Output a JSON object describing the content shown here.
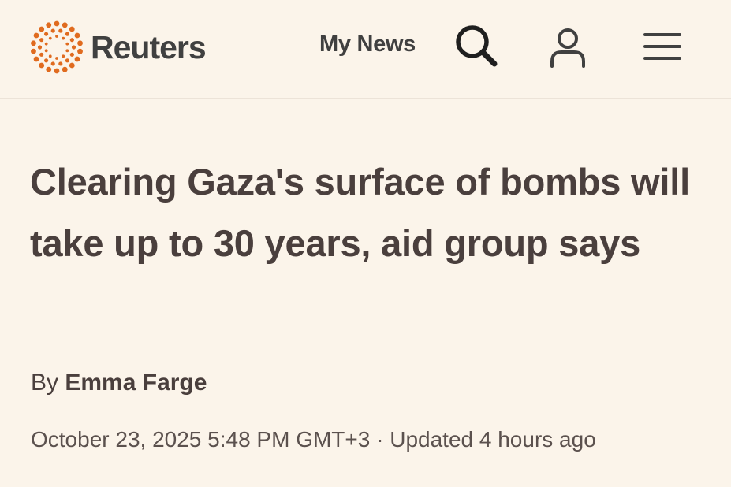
{
  "header": {
    "logo_text": "Reuters",
    "my_news_label": "My News",
    "icons": {
      "logo": "reuters-dots-logo",
      "search": "search-icon",
      "account": "user-icon",
      "menu": "hamburger-menu-icon"
    }
  },
  "article": {
    "headline": "Clearing Gaza's surface of bombs will take up to 30 years, aid group says",
    "byline_prefix": "By",
    "author": "Emma Farge",
    "published": "October 23, 2025 5:48 PM GMT+3",
    "separator": "·",
    "updated": "Updated 4 hours ago"
  },
  "colors": {
    "background": "#fbf4ea",
    "brand_orange": "#e06b1f",
    "text_dark": "#404040",
    "headline": "#4a3f3d",
    "divider": "#ece3d8"
  }
}
